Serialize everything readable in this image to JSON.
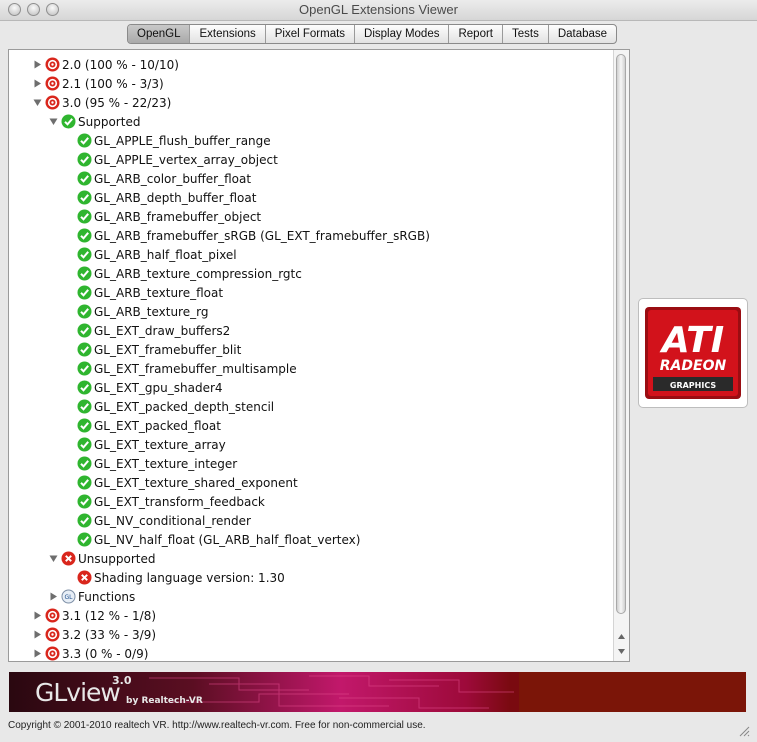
{
  "window": {
    "title": "OpenGL Extensions Viewer"
  },
  "tabs": [
    "OpenGL",
    "Extensions",
    "Pixel Formats",
    "Display Modes",
    "Report",
    "Tests",
    "Database"
  ],
  "active_tab": "OpenGL",
  "tree": [
    {
      "kind": "version",
      "label": "2.0 (100 % - 10/10)",
      "expanded": false
    },
    {
      "kind": "version",
      "label": "2.1 (100 % - 3/3)",
      "expanded": false
    },
    {
      "kind": "version",
      "label": "3.0 (95 % - 22/23)",
      "expanded": true
    },
    {
      "kind": "group-ok",
      "label": "Supported",
      "expanded": true
    },
    {
      "kind": "ext-ok",
      "label": "GL_APPLE_flush_buffer_range"
    },
    {
      "kind": "ext-ok",
      "label": "GL_APPLE_vertex_array_object"
    },
    {
      "kind": "ext-ok",
      "label": "GL_ARB_color_buffer_float"
    },
    {
      "kind": "ext-ok",
      "label": "GL_ARB_depth_buffer_float"
    },
    {
      "kind": "ext-ok",
      "label": "GL_ARB_framebuffer_object"
    },
    {
      "kind": "ext-ok",
      "label": "GL_ARB_framebuffer_sRGB (GL_EXT_framebuffer_sRGB)"
    },
    {
      "kind": "ext-ok",
      "label": "GL_ARB_half_float_pixel"
    },
    {
      "kind": "ext-ok",
      "label": "GL_ARB_texture_compression_rgtc"
    },
    {
      "kind": "ext-ok",
      "label": "GL_ARB_texture_float"
    },
    {
      "kind": "ext-ok",
      "label": "GL_ARB_texture_rg"
    },
    {
      "kind": "ext-ok",
      "label": "GL_EXT_draw_buffers2"
    },
    {
      "kind": "ext-ok",
      "label": "GL_EXT_framebuffer_blit"
    },
    {
      "kind": "ext-ok",
      "label": "GL_EXT_framebuffer_multisample"
    },
    {
      "kind": "ext-ok",
      "label": "GL_EXT_gpu_shader4"
    },
    {
      "kind": "ext-ok",
      "label": "GL_EXT_packed_depth_stencil"
    },
    {
      "kind": "ext-ok",
      "label": "GL_EXT_packed_float"
    },
    {
      "kind": "ext-ok",
      "label": "GL_EXT_texture_array"
    },
    {
      "kind": "ext-ok",
      "label": "GL_EXT_texture_integer"
    },
    {
      "kind": "ext-ok",
      "label": "GL_EXT_texture_shared_exponent"
    },
    {
      "kind": "ext-ok",
      "label": "GL_EXT_transform_feedback"
    },
    {
      "kind": "ext-ok",
      "label": "GL_NV_conditional_render"
    },
    {
      "kind": "ext-ok",
      "label": "GL_NV_half_float (GL_ARB_half_float_vertex)"
    },
    {
      "kind": "group-bad",
      "label": "Unsupported",
      "expanded": true
    },
    {
      "kind": "ext-bad",
      "label": "Shading language version: 1.30"
    },
    {
      "kind": "functions",
      "label": "Functions",
      "expanded": false
    },
    {
      "kind": "version",
      "label": "3.1 (12 % - 1/8)",
      "expanded": false
    },
    {
      "kind": "version",
      "label": "3.2 (33 % - 3/9)",
      "expanded": false
    },
    {
      "kind": "version",
      "label": "3.3 (0 % - 0/9)",
      "expanded": false
    }
  ],
  "gpu_logo": {
    "brand": "ATI",
    "line2": "RADEON",
    "line3": "GRAPHICS",
    "color": "#d2121b"
  },
  "banner": {
    "product": "GLview",
    "version": "3.0",
    "byline": "by Realtech-VR"
  },
  "footer": {
    "copyright": "Copyright © 2001-2010 realtech VR. http://www.realtech-vr.com. Free for non-commercial use."
  },
  "colors": {
    "ok": "#2fb52f",
    "bad": "#d9261c",
    "version_icon": "#d9261c"
  }
}
